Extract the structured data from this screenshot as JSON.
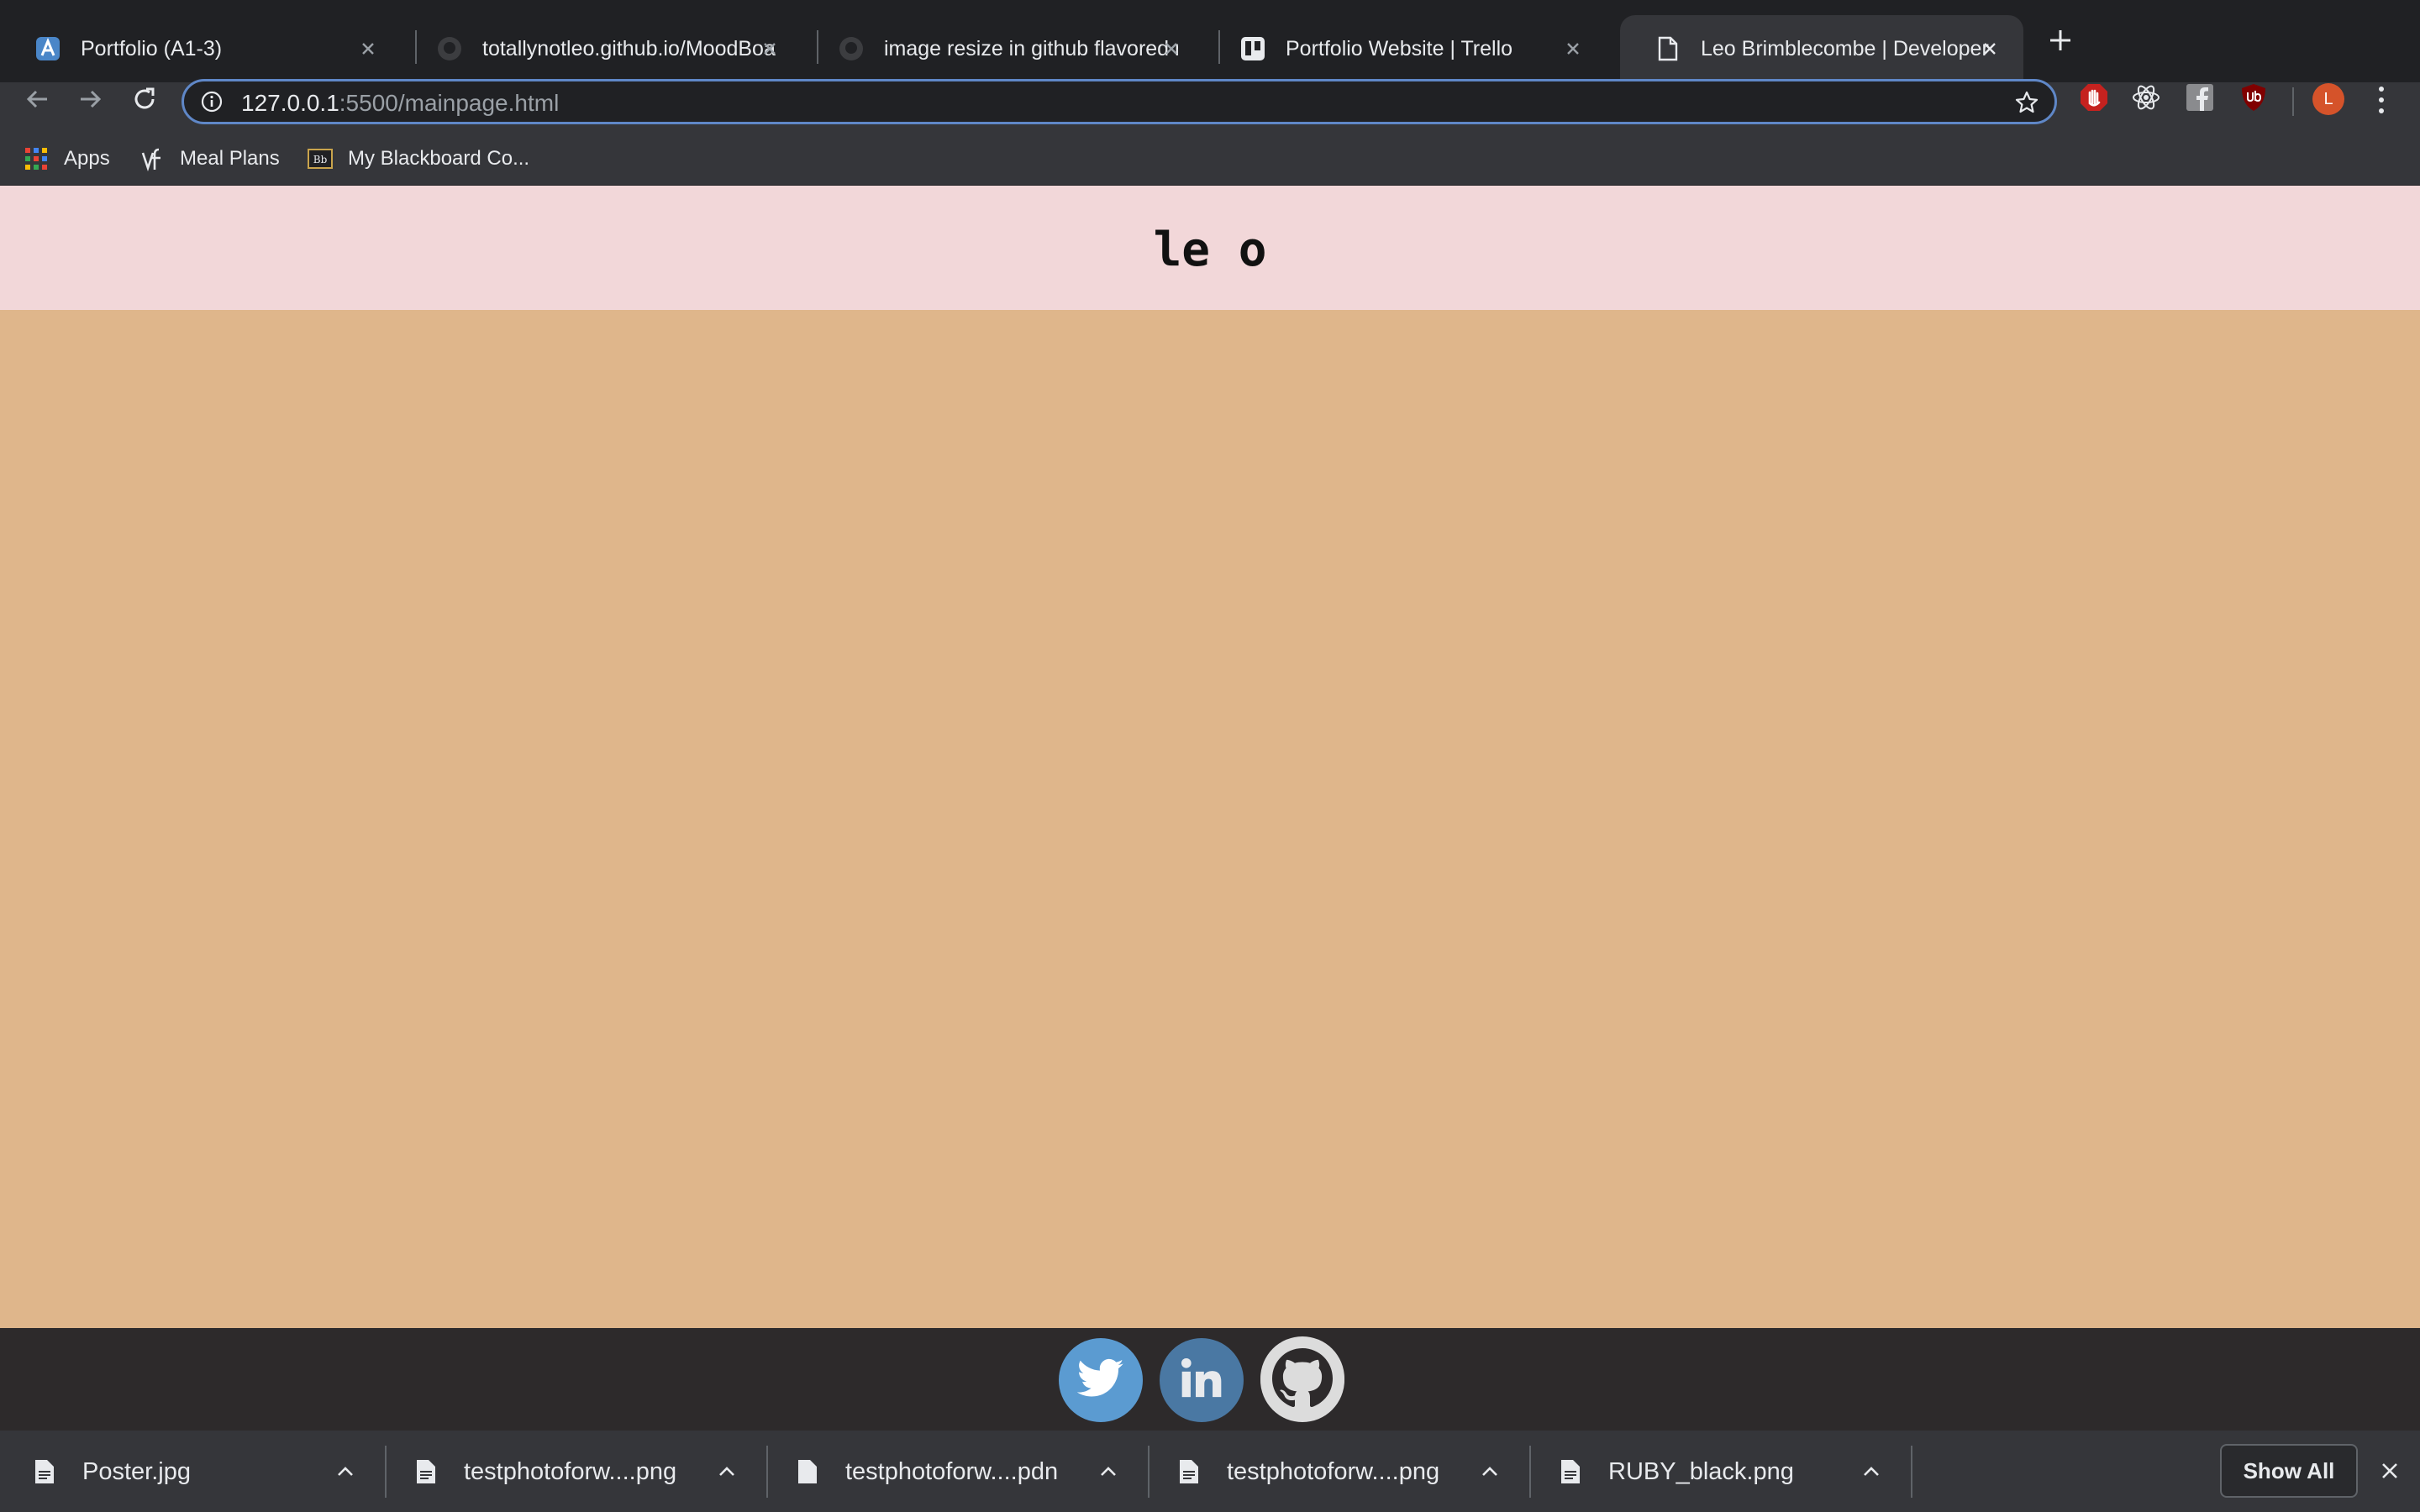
{
  "browser": {
    "tabs": [
      {
        "title": "Portfolio (A1-3)",
        "favicon": "portfolio-a-icon",
        "active": false
      },
      {
        "title": "totallynotleo.github.io/MoodBoard",
        "favicon": "github-icon",
        "active": false
      },
      {
        "title": "image resize in github flavored markdown",
        "favicon": "github-icon",
        "active": false
      },
      {
        "title": "Portfolio Website | Trello",
        "favicon": "trello-icon",
        "active": false
      },
      {
        "title": "Leo Brimblecombe | Developer",
        "favicon": "page-icon",
        "active": true
      }
    ],
    "url_host": "127.0.0.1",
    "url_rest": ":5500/mainpage.html",
    "bookmarks": [
      {
        "label": "Apps",
        "icon": "apps-grid-icon"
      },
      {
        "label": "Meal Plans",
        "icon": "vf-icon"
      },
      {
        "label": "My Blackboard Co...",
        "icon": "blackboard-icon"
      }
    ],
    "avatar_letter": "L",
    "colors": {
      "chrome_dark": "#202124",
      "chrome_toolbar": "#35363a",
      "omnibox_focus": "#5f87c7"
    }
  },
  "page": {
    "logo_text": "le o",
    "colors": {
      "header": "#f2d7d9",
      "body": "#dfb68b",
      "footer": "#2d2a2b"
    },
    "social_links": [
      {
        "name": "twitter",
        "icon": "twitter-icon",
        "color": "#5b9bd1"
      },
      {
        "name": "linkedin",
        "icon": "linkedin-icon",
        "color": "#4a78a3"
      },
      {
        "name": "github",
        "icon": "github-icon",
        "color": "#dcdcdc"
      }
    ]
  },
  "downloads": {
    "items": [
      {
        "name": "Poster.jpg"
      },
      {
        "name": "testphotoforw....png"
      },
      {
        "name": "testphotoforw....pdn"
      },
      {
        "name": "testphotoforw....png"
      },
      {
        "name": "RUBY_black.png"
      }
    ],
    "show_all_label": "Show All"
  }
}
